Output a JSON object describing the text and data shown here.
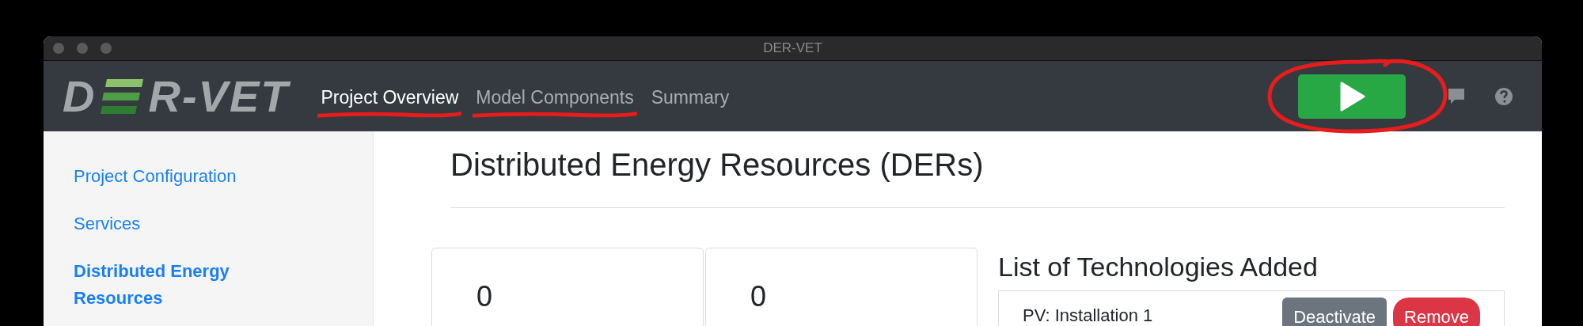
{
  "window": {
    "title": "DER-VET"
  },
  "header": {
    "logo": {
      "before": "D",
      "after": "R-VET"
    },
    "nav": [
      {
        "label": "Project Overview",
        "selected": true,
        "annotated": true
      },
      {
        "label": "Model Components",
        "selected": false,
        "annotated": true
      },
      {
        "label": "Summary",
        "selected": false,
        "annotated": false
      }
    ],
    "run_button": {
      "annotated": true
    }
  },
  "sidebar": {
    "items": [
      {
        "label": "Project Configuration",
        "selected": false
      },
      {
        "label": "Services",
        "selected": false
      },
      {
        "label": "Distributed Energy Resources",
        "selected": true
      }
    ]
  },
  "main": {
    "title": "Distributed Energy Resources (DERs)",
    "cards": [
      {
        "count": "0"
      },
      {
        "count": "0"
      }
    ],
    "technologies": {
      "title": "List of Technologies Added",
      "items": [
        {
          "name": "PV: Installation 1",
          "buttons": [
            "Deactivate",
            "Remove"
          ]
        }
      ]
    }
  }
}
